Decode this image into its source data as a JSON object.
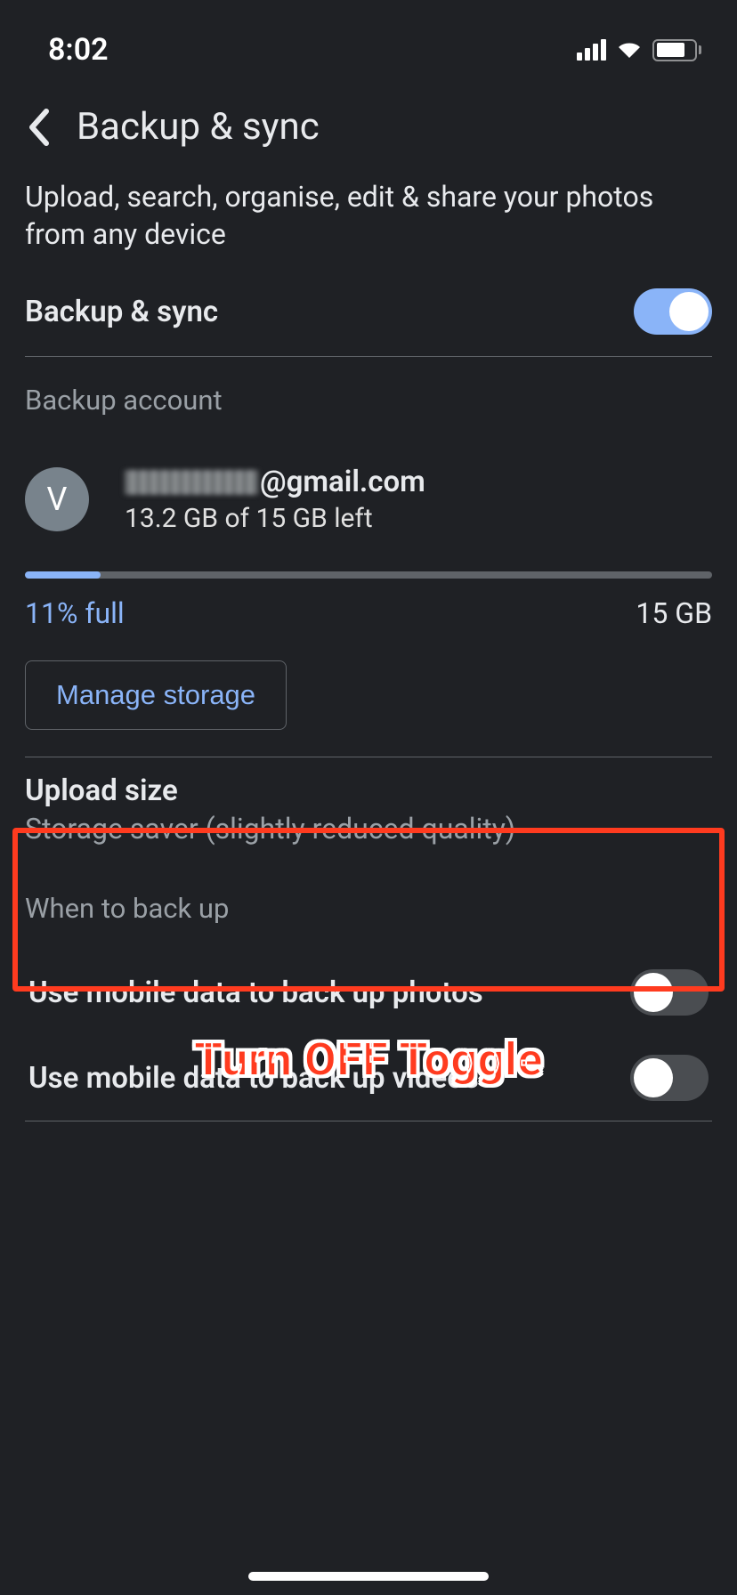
{
  "status": {
    "time": "8:02"
  },
  "header": {
    "title": "Backup & sync"
  },
  "description": "Upload, search, organise, edit & share your photos from any device",
  "backup_toggle": {
    "label": "Backup & sync"
  },
  "account_section": {
    "caption": "Backup account",
    "avatar_letter": "V",
    "email_suffix": "@gmail.com",
    "storage_left": "13.2 GB of 15 GB left",
    "percent_label": "11% full",
    "total_label": "15 GB",
    "progress_percent": 11
  },
  "manage_button": "Manage storage",
  "upload": {
    "title": "Upload size",
    "subtitle": "Storage saver (slightly reduced quality)"
  },
  "when_caption": "When to back up",
  "mobile_photos": {
    "label": "Use mobile data to back up photos"
  },
  "mobile_videos": {
    "label": "Use mobile data to back up videos"
  },
  "annotation": "Turn OFF Toggle"
}
